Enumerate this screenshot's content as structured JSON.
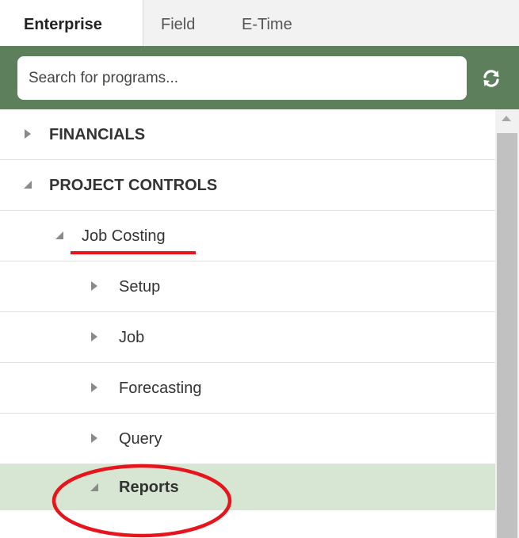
{
  "tabs": [
    {
      "label": "Enterprise",
      "active": true
    },
    {
      "label": "Field",
      "active": false
    },
    {
      "label": "E-Time",
      "active": false
    }
  ],
  "search": {
    "placeholder": "Search for programs...",
    "value": ""
  },
  "refresh_icon": "refresh-icon",
  "tree": [
    {
      "label": "FINANCIALS",
      "level": 0,
      "expanded": false,
      "selected": false
    },
    {
      "label": "PROJECT CONTROLS",
      "level": 0,
      "expanded": true,
      "selected": false
    },
    {
      "label": "Job Costing",
      "level": 1,
      "expanded": true,
      "selected": false
    },
    {
      "label": "Setup",
      "level": 2,
      "expanded": false,
      "selected": false
    },
    {
      "label": "Job",
      "level": 2,
      "expanded": false,
      "selected": false
    },
    {
      "label": "Forecasting",
      "level": 2,
      "expanded": false,
      "selected": false
    },
    {
      "label": "Query",
      "level": 2,
      "expanded": false,
      "selected": false
    },
    {
      "label": "Reports",
      "level": 2,
      "expanded": true,
      "selected": true
    }
  ],
  "colors": {
    "header_bar": "#5e7f5b",
    "selected_row": "#d6e6d3",
    "annotation": "#e8141c"
  }
}
